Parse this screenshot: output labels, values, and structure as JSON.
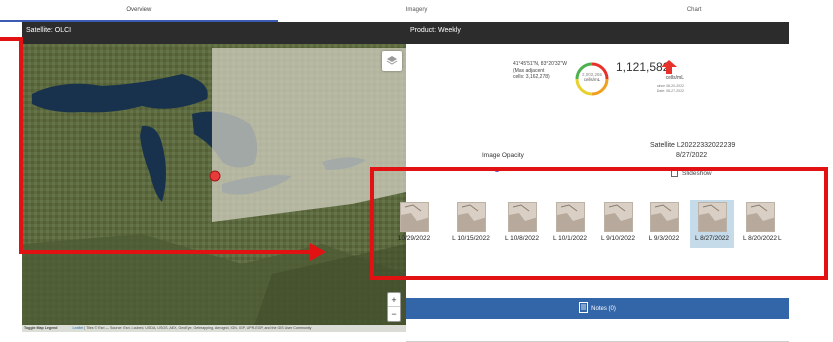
{
  "tabs": [
    {
      "label": "Overview"
    },
    {
      "label": "Imagery"
    },
    {
      "label": "Chart"
    }
  ],
  "left_header": "Satellite: OLCI",
  "right_header": "Product: Weekly",
  "info": {
    "coords": "41°45'51\"N, 83°20'32\"W",
    "max_adjacent": "(Max adjacent",
    "cells": "cells: 3,162,278)",
    "gauge_value": "2,002,265",
    "gauge_units": "cells/mL",
    "big_value": "1,121,582",
    "big_units": "cells/mL",
    "since": "since 08-20-2022",
    "date": "Date: 08-27-2022"
  },
  "satellite_label": "Satellite L20222332022239",
  "satellite_date": "8/27/2022",
  "image_opacity_label": "Image Opacity",
  "slideshow_label": "Slideshow",
  "thumbnails": [
    {
      "label": "10/29/2022"
    },
    {
      "label": "L 10/15/2022"
    },
    {
      "label": "L 10/8/2022"
    },
    {
      "label": "L 10/1/2022"
    },
    {
      "label": "L 9/10/2022"
    },
    {
      "label": "L 9/3/2022"
    },
    {
      "label": "L 8/27/2022"
    },
    {
      "label": "L 8/20/2022"
    },
    {
      "label": "L"
    }
  ],
  "notes_label": "Notes (0)",
  "map": {
    "toggle_legend": "Toggle Map Legend",
    "leaflet": "Leaflet",
    "attribution": "| Tiles © Esri — Source: Esri, i-cubed, USDA, USGS, AEX, GeoEye, Getmapping, Aerogrid, IGN, IGP, UPR-EGP, and the GIS User Community",
    "zoom_in": "+",
    "zoom_out": "−"
  },
  "colors": {
    "header_bg": "#2c2c2c",
    "notes_bg": "#3366a8",
    "selected_thumb": "#c6dbe9",
    "annotation_red": "#e31212",
    "arrow_red": "#e8312a"
  }
}
